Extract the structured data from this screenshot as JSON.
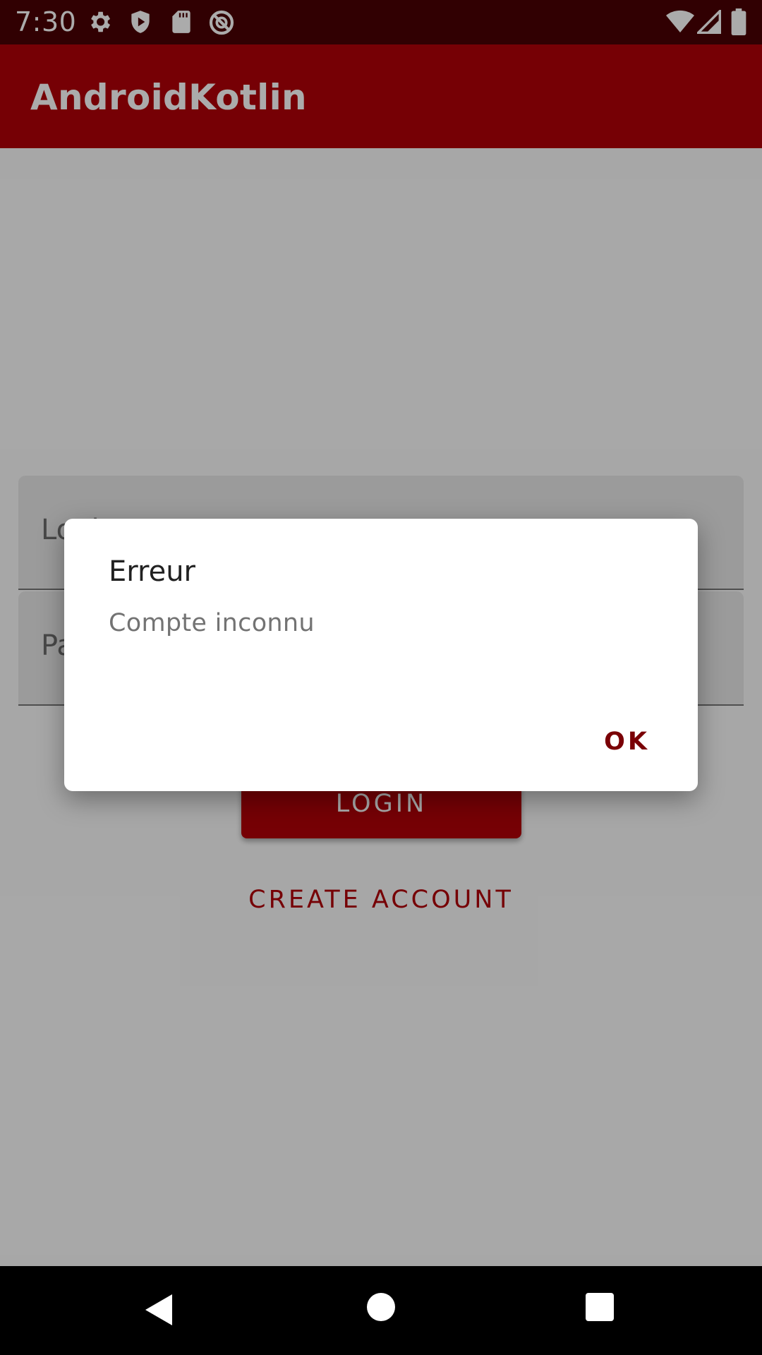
{
  "status_bar": {
    "time": "7:30",
    "left_icons": [
      "gear-icon",
      "shield-play-icon",
      "sd-card-icon",
      "no-disturb-icon"
    ],
    "right_icons": [
      "wifi-icon",
      "cell-signal-icon",
      "battery-icon"
    ]
  },
  "app_bar": {
    "title": "AndroidKotlin"
  },
  "form": {
    "login_label": "Login",
    "password_label": "Password",
    "login_button": "LOGIN",
    "create_account_button": "CREATE ACCOUNT"
  },
  "dialog": {
    "title": "Erreur",
    "message": "Compte inconnu",
    "ok_button": "OK"
  },
  "colors": {
    "primary": "#b00008",
    "primary_dark": "#4a0004",
    "accent_text": "#7a0006"
  },
  "nav_bar": {
    "icons": [
      "back-icon",
      "home-icon",
      "recents-icon"
    ]
  }
}
